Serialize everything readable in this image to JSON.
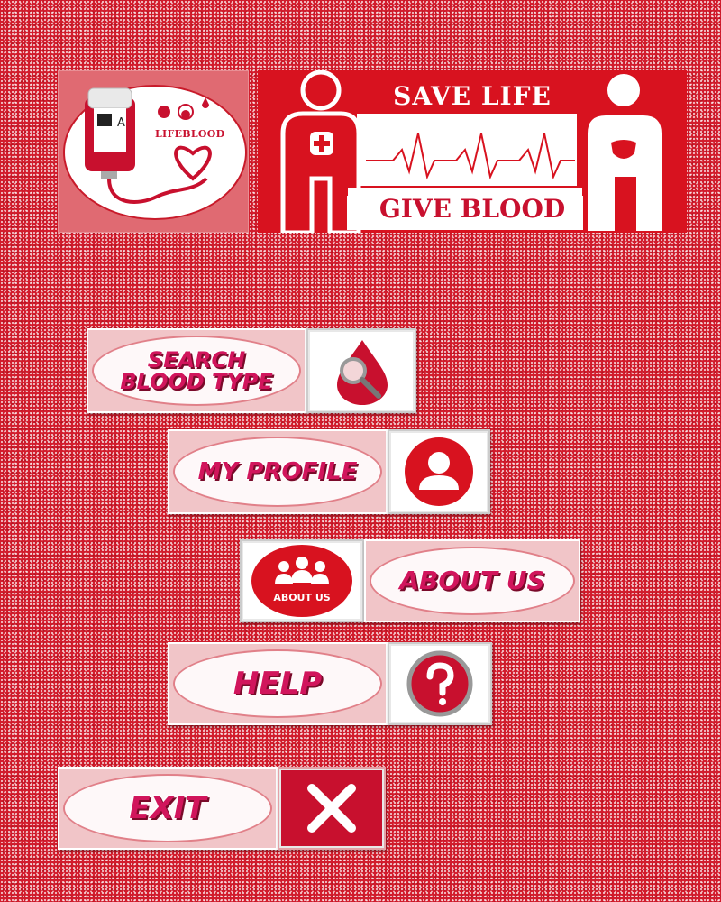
{
  "logo": {
    "brand_text": "LIFEBLOOD",
    "bag_label": "A"
  },
  "banner": {
    "line1": "SAVE LIFE",
    "line2": "GIVE BLOOD"
  },
  "menu": {
    "search": {
      "label": "SEARCH BLOOD TYPE",
      "icon": "blood-drop-magnifier-icon"
    },
    "profile": {
      "label": "MY PROFILE",
      "icon": "user-icon"
    },
    "about": {
      "label": "ABOUT US",
      "icon_caption": "ABOUT US",
      "icon": "group-icon"
    },
    "help": {
      "label": "HELP",
      "icon": "question-icon"
    },
    "exit": {
      "label": "EXIT",
      "icon": "close-icon"
    }
  },
  "colors": {
    "primary_red": "#d8121f",
    "label_pink": "#d1155c",
    "background": "#d21c2c"
  }
}
